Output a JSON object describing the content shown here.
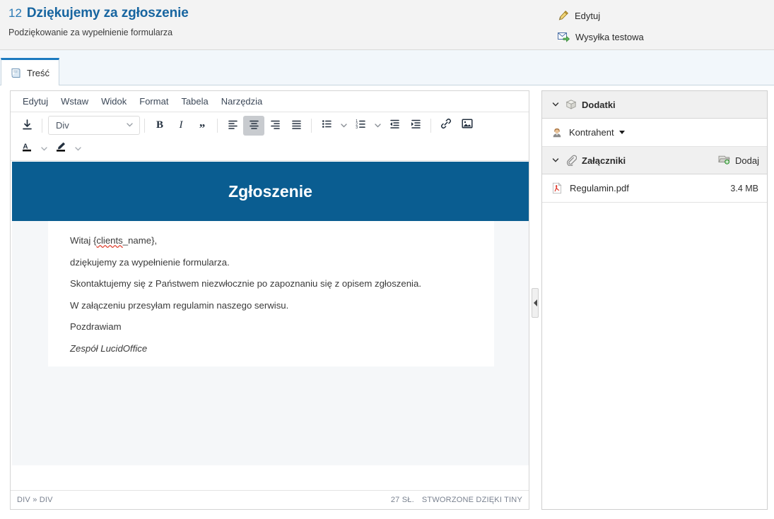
{
  "header": {
    "number": "12",
    "title": "Dziękujemy za zgłoszenie",
    "subtitle": "Podziękowanie za wypełnienie formularza",
    "actions": [
      {
        "label": "Edytuj",
        "icon": "pencil-icon"
      },
      {
        "label": "Wysyłka testowa",
        "icon": "mail-send-icon"
      }
    ]
  },
  "tabs": [
    {
      "label": "Treść",
      "icon": "document-icon",
      "active": true
    }
  ],
  "editor": {
    "menus": [
      "Edytuj",
      "Wstaw",
      "Widok",
      "Format",
      "Tabela",
      "Narzędzia"
    ],
    "toolbar": {
      "save_icon": "save-icon",
      "format_select": {
        "value": "Div",
        "caret": "chevron-down-icon"
      },
      "bold": "B",
      "italic": "I",
      "blockquote": "”",
      "align": [
        "align-left-icon",
        "align-center-icon",
        "align-right-icon",
        "align-justify-icon"
      ],
      "active_align": "align-center-icon",
      "bullet_list": "bullet-list-icon",
      "numbered_list": "numbered-list-icon",
      "outdent": "outdent-icon",
      "indent": "indent-icon",
      "link": "link-icon",
      "image": "image-icon",
      "text_color": "text-color-icon",
      "background_color": "highlight-color-icon"
    },
    "content": {
      "banner_title": "Zgłoszenie",
      "banner_color": "#0a5d91",
      "paragraphs": [
        {
          "text_before": "Witaj {",
          "misspelled": "clients",
          "text_after": "_name},",
          "italic": false
        },
        {
          "text": "dziękujemy za wypełnienie formularza.",
          "italic": false
        },
        {
          "text": "Skontaktujemy się z Państwem niezwłocznie po zapoznaniu się z opisem zgłoszenia.",
          "italic": false
        },
        {
          "text": "W załączeniu przesyłam regulamin naszego serwisu.",
          "italic": false
        },
        {
          "text": "Pozdrawiam",
          "italic": false
        },
        {
          "text": "Zespół LucidOffice",
          "italic": true
        }
      ]
    },
    "statusbar": {
      "path": "DIV » DIV",
      "words": "27 SŁ.",
      "powered_by": "STWORZONE DZIĘKI TINY"
    }
  },
  "side_panel": {
    "sections": [
      {
        "title": "Dodatki",
        "icon": "box-icon",
        "chevron": "chevron-down-icon",
        "rows": [
          {
            "label": "Kontrahent",
            "icon": "user-icon",
            "has_caret": true
          }
        ]
      },
      {
        "title": "Załączniki",
        "icon": "paperclip-icon",
        "chevron": "chevron-down-icon",
        "action": {
          "label": "Dodaj",
          "icon": "add-attachment-icon"
        },
        "files": [
          {
            "name": "Regulamin.pdf",
            "size": "3.4 MB",
            "icon": "pdf-icon"
          }
        ]
      }
    ]
  },
  "collapse_handle": {
    "icon": "triangle-left-icon"
  }
}
